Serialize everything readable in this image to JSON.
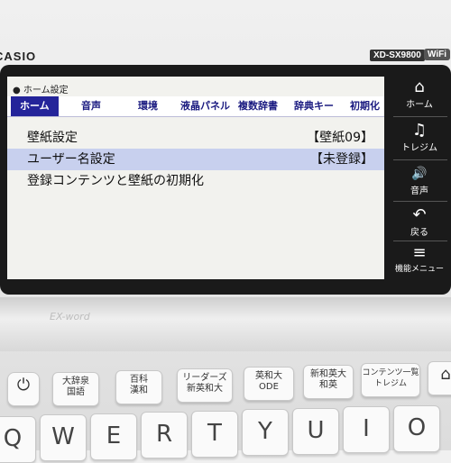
{
  "device": {
    "brand": "CASIO",
    "model": "XD-SX9800",
    "wifi": "WiFi"
  },
  "screen": {
    "breadcrumb": "● ホーム設定",
    "tabs": [
      {
        "label": "ホーム",
        "active": true
      },
      {
        "label": "音声"
      },
      {
        "label": "環境"
      },
      {
        "label": "液晶パネル"
      },
      {
        "label": "複数辞書"
      },
      {
        "label": "辞典キー"
      },
      {
        "label": "初期化"
      }
    ],
    "rows": [
      {
        "label": "壁紙設定",
        "value": "【壁紙09】"
      },
      {
        "label": "ユーザー名設定",
        "value": "【未登録】"
      },
      {
        "label": "登録コンテンツと壁紙の初期化",
        "value": ""
      }
    ]
  },
  "side_buttons": [
    {
      "icon": "⌂",
      "label": "ホーム",
      "icon_name": "home-icon"
    },
    {
      "icon": "♫",
      "label": "トレジム",
      "icon_name": "treasure-icon"
    },
    {
      "icon": "🔊",
      "label": "音声",
      "icon_name": "speaker-icon"
    },
    {
      "icon": "↶",
      "label": "戻る",
      "icon_name": "back-icon"
    },
    {
      "icon": "≡",
      "label": "機能メニュー",
      "icon_name": "menu-icon"
    }
  ],
  "hinge_logo": "EX-word",
  "function_keys": [
    {
      "label": "⏻",
      "icon_name": "power-icon"
    },
    {
      "label": "大辞泉\n国語"
    },
    {
      "label": "百科\n漢和"
    },
    {
      "label": "リーダーズ\n新英和大"
    },
    {
      "label": "英和大\nODE"
    },
    {
      "label": "新和英大\n和英"
    },
    {
      "label": "コンテンツ一覧\nトレジム"
    },
    {
      "label": "⌂",
      "icon_name": "home-icon"
    }
  ],
  "letter_keys": [
    "Q",
    "W",
    "E",
    "R",
    "T",
    "Y",
    "U",
    "I",
    "O"
  ]
}
